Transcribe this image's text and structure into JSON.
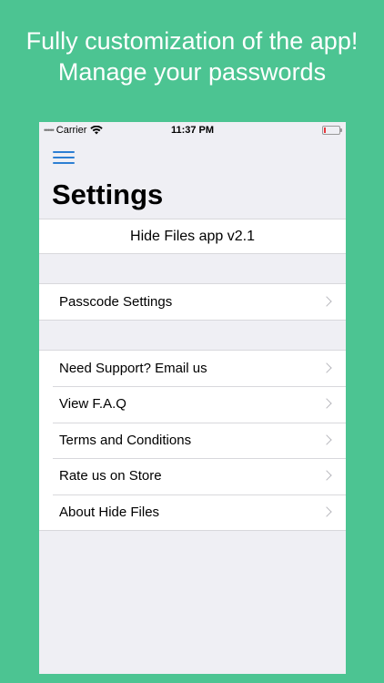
{
  "banner": {
    "line1": "Fully customization of the app!",
    "line2": "Manage your passwords"
  },
  "status_bar": {
    "signal": "•••••",
    "carrier": "Carrier",
    "time": "11:37 PM",
    "battery_level": 0.1,
    "battery_color": "#e8383d"
  },
  "header": {
    "menu_icon": "hamburger-menu-icon",
    "title": "Settings"
  },
  "version": "Hide Files app v2.1",
  "groups": [
    {
      "rows": [
        {
          "label": "Passcode Settings",
          "icon": "chevron-right-icon"
        }
      ]
    },
    {
      "rows": [
        {
          "label": "Need Support? Email us",
          "icon": "chevron-right-icon"
        },
        {
          "label": "View F.A.Q",
          "icon": "chevron-right-icon"
        },
        {
          "label": "Terms and Conditions",
          "icon": "chevron-right-icon"
        },
        {
          "label": "Rate us on Store",
          "icon": "chevron-right-icon"
        },
        {
          "label": "About Hide Files",
          "icon": "chevron-right-icon"
        }
      ]
    }
  ],
  "colors": {
    "background": "#4cc492",
    "accent": "#2d7fd3",
    "screen": "#efeff4"
  }
}
